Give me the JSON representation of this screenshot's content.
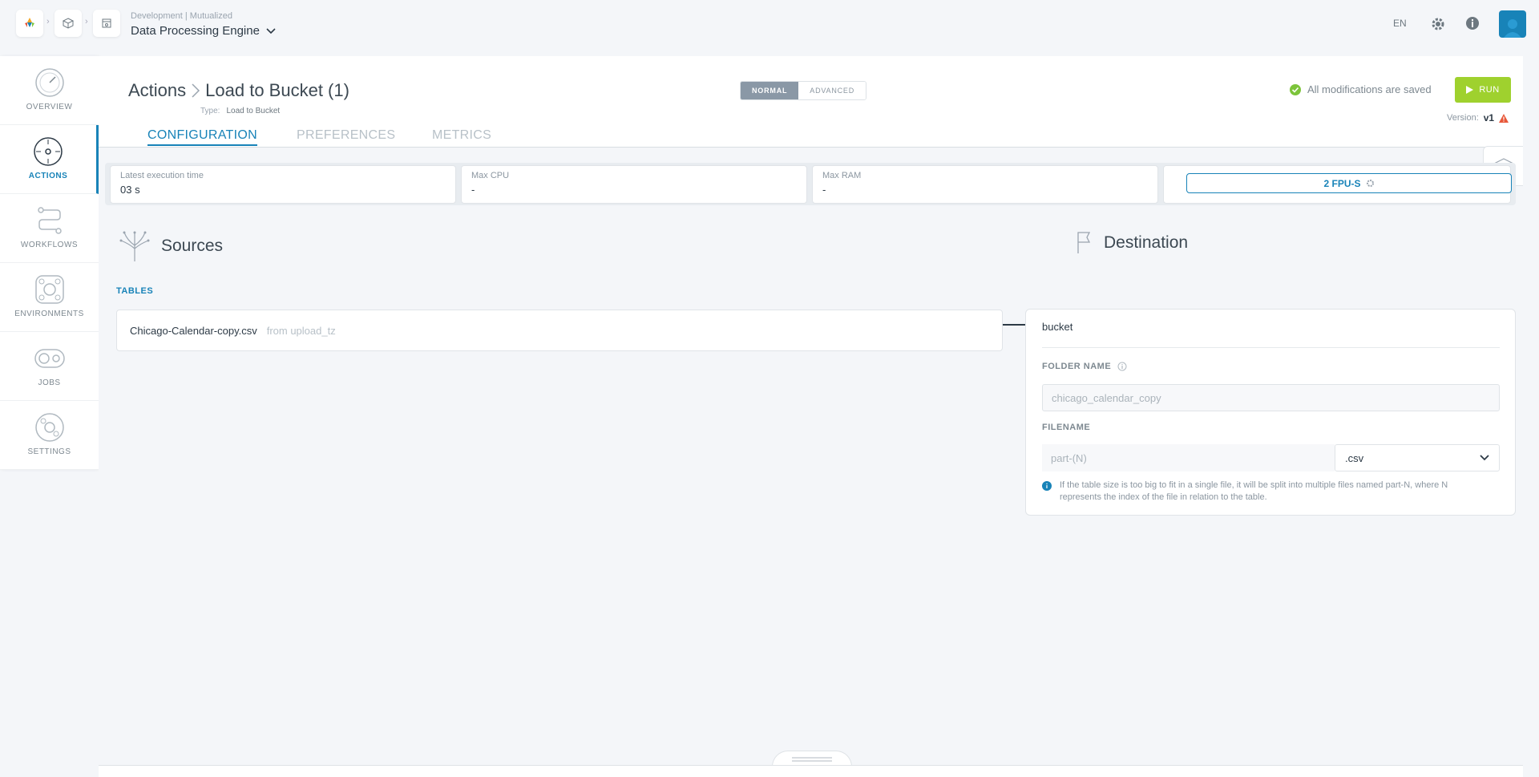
{
  "topbar": {
    "context_sub": "Development | Mutualized",
    "context_main": "Data Processing Engine",
    "language": "EN"
  },
  "sidebar": {
    "items": [
      {
        "label": "OVERVIEW",
        "icon": "gauge-icon"
      },
      {
        "label": "ACTIONS",
        "icon": "target-icon"
      },
      {
        "label": "WORKFLOWS",
        "icon": "workflow-icon"
      },
      {
        "label": "ENVIRONMENTS",
        "icon": "environment-icon"
      },
      {
        "label": "JOBS",
        "icon": "jobs-icon"
      },
      {
        "label": "SETTINGS",
        "icon": "settings-icon"
      }
    ]
  },
  "header": {
    "breadcrumb_root": "Actions",
    "breadcrumb_current": "Load to Bucket (1)",
    "type_label": "Type:",
    "type_value": "Load to Bucket",
    "mode_normal": "NORMAL",
    "mode_advanced": "ADVANCED",
    "saved_status": "All modifications are saved",
    "run_label": "RUN",
    "version_label": "Version:",
    "version_value": "v1"
  },
  "tabs": [
    "CONFIGURATION",
    "PREFERENCES",
    "METRICS"
  ],
  "stats": {
    "latest_execution_label": "Latest execution time",
    "latest_execution_value": "03 s",
    "max_cpu_label": "Max CPU",
    "max_cpu_value": "-",
    "max_ram_label": "Max RAM",
    "max_ram_value": "-",
    "fpu_label": "2 FPU-S"
  },
  "sources": {
    "title": "Sources",
    "tables_label": "TABLES",
    "table_name": "Chicago-Calendar-copy.csv",
    "table_from": "from upload_tz"
  },
  "destination": {
    "title": "Destination",
    "name": "bucket",
    "folder_label": "FOLDER NAME",
    "folder_placeholder": "chicago_calendar_copy",
    "filename_label": "FILENAME",
    "filename_placeholder": "part-(N)",
    "extension": ".csv",
    "hint": "If the table size is too big to fit in a single file, it will be split into multiple files named part-N, where N represents the index of the file in relation to the table."
  },
  "colors": {
    "accent": "#1883b8",
    "run": "#9fd12e",
    "saved_check": "#7cc43a",
    "warning": "#e8583a"
  }
}
